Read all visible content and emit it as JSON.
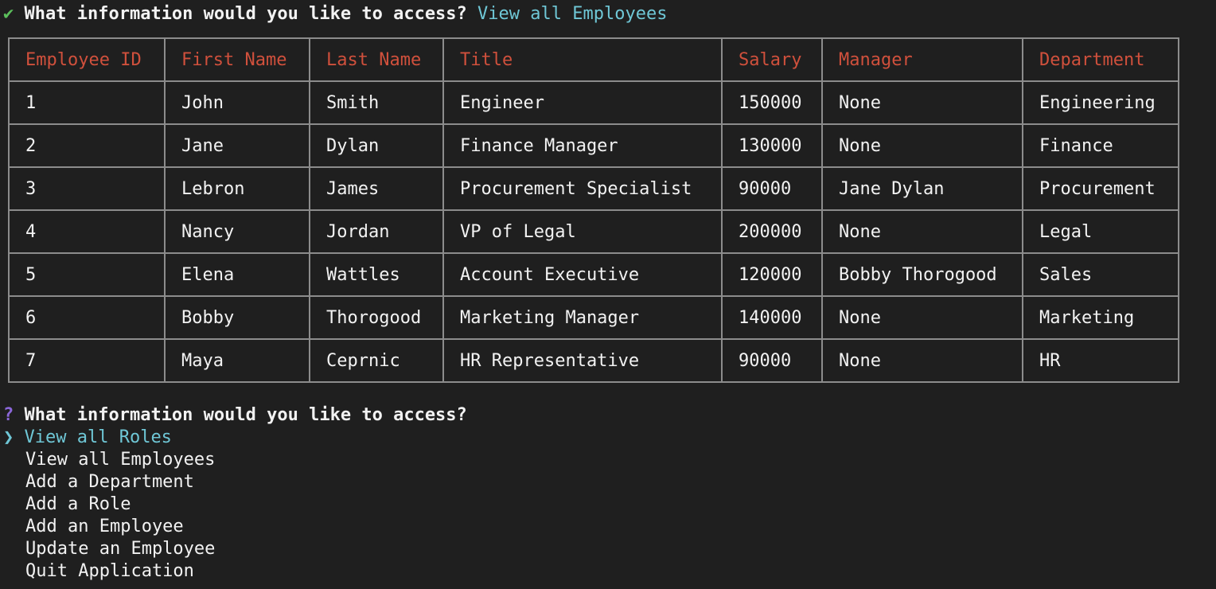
{
  "prompt1": {
    "icon": "✔",
    "question": "What information would you like to access?",
    "answer": "View all Employees"
  },
  "table": {
    "headers": [
      "Employee ID",
      "First Name",
      "Last Name",
      "Title",
      "Salary",
      "Manager",
      "Department"
    ],
    "rows": [
      [
        "1",
        "John",
        "Smith",
        "Engineer",
        "150000",
        "None",
        "Engineering"
      ],
      [
        "2",
        "Jane",
        "Dylan",
        "Finance Manager",
        "130000",
        "None",
        "Finance"
      ],
      [
        "3",
        "Lebron",
        "James",
        "Procurement Specialist",
        "90000",
        "Jane Dylan",
        "Procurement"
      ],
      [
        "4",
        "Nancy",
        "Jordan",
        "VP of Legal",
        "200000",
        "None",
        "Legal"
      ],
      [
        "5",
        "Elena",
        "Wattles",
        "Account Executive",
        "120000",
        "Bobby Thorogood",
        "Sales"
      ],
      [
        "6",
        "Bobby",
        "Thorogood",
        "Marketing Manager",
        "140000",
        "None",
        "Marketing"
      ],
      [
        "7",
        "Maya",
        "Ceprnic",
        "HR Representative",
        "90000",
        "None",
        "HR"
      ]
    ]
  },
  "prompt2": {
    "icon": "?",
    "question": "What information would you like to access?",
    "pointer": "❯",
    "options": [
      "View all Roles",
      "View all Employees",
      "Add a Department",
      "Add a Role",
      "Add an Employee",
      "Update an Employee",
      "Quit Application"
    ]
  }
}
